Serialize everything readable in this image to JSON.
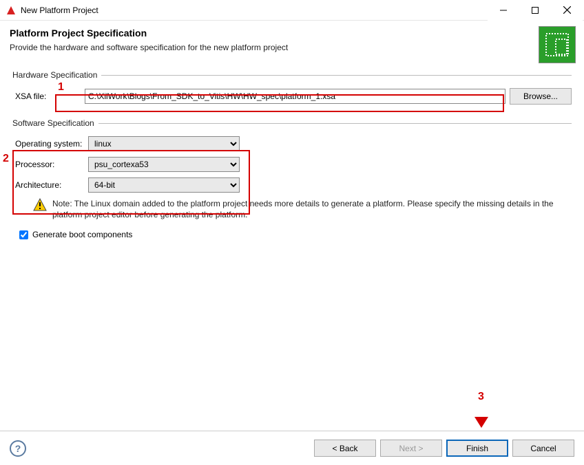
{
  "window": {
    "title": "New Platform Project"
  },
  "header": {
    "title": "Platform Project Specification",
    "description": "Provide the hardware and software specification for the new platform project"
  },
  "hardware": {
    "legend": "Hardware Specification",
    "xsa_label": "XSA file:",
    "xsa_value": "C:\\XilWork\\Blogs\\From_SDK_to_Vitis\\HW\\HW_spec\\platform_1.xsa",
    "browse_label": "Browse..."
  },
  "software": {
    "legend": "Software Specification",
    "os_label": "Operating system:",
    "os_value": "linux",
    "proc_label": "Processor:",
    "proc_value": "psu_cortexa53",
    "arch_label": "Architecture:",
    "arch_value": "64-bit",
    "note": "Note: The Linux domain added to the platform project needs more details to generate a platform. Please specify the missing details in the platform project editor before generating the platform.",
    "checkbox_label": "Generate boot components",
    "checkbox_checked": true
  },
  "footer": {
    "back": "< Back",
    "next": "Next >",
    "finish": "Finish",
    "cancel": "Cancel"
  },
  "annotations": {
    "n1": "1",
    "n2": "2",
    "n3": "3"
  }
}
